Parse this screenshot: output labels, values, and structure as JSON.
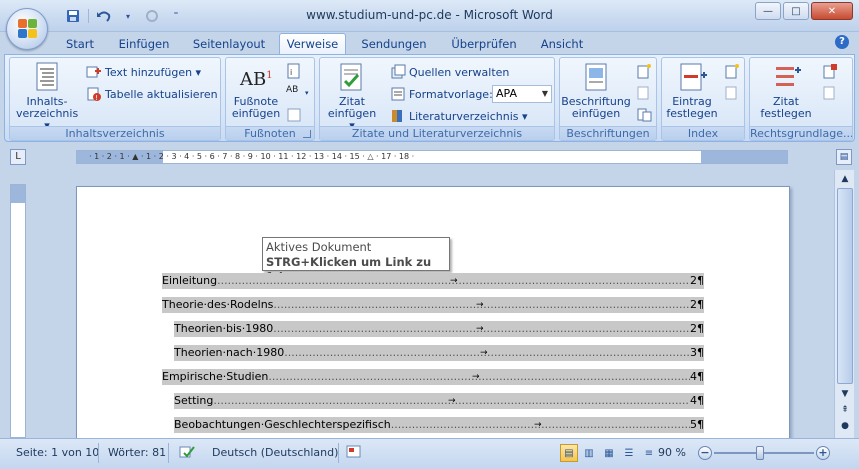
{
  "window": {
    "title": "www.studium-und-pc.de - Microsoft Word",
    "controls": {
      "minimize": "—",
      "maximize": "□",
      "close": "✕"
    }
  },
  "qat": {
    "save_icon": "save-icon",
    "undo_icon": "undo-icon",
    "redo_icon": "redo-icon",
    "customize_icon": "chevron-down-icon"
  },
  "tabs": [
    {
      "label": "Start",
      "active": false
    },
    {
      "label": "Einfügen",
      "active": false
    },
    {
      "label": "Seitenlayout",
      "active": false
    },
    {
      "label": "Verweise",
      "active": true
    },
    {
      "label": "Sendungen",
      "active": false
    },
    {
      "label": "Überprüfen",
      "active": false
    },
    {
      "label": "Ansicht",
      "active": false
    }
  ],
  "ribbon": {
    "groups": [
      {
        "label": "Inhaltsverzeichnis",
        "big": {
          "line1": "Inhalts-",
          "line2": "verzeichnis ▾"
        },
        "small": [
          {
            "label": "Text hinzufügen ▾"
          },
          {
            "label": "Tabelle aktualisieren"
          }
        ]
      },
      {
        "label": "Fußnoten",
        "big": {
          "line1": "Fußnote",
          "line2": "einfügen",
          "icon_text": "AB",
          "sup": "1"
        }
      },
      {
        "label": "Zitate und Literaturverzeichnis",
        "big": {
          "line1": "Zitat",
          "line2": "einfügen ▾"
        },
        "small": [
          {
            "label": "Quellen verwalten"
          },
          {
            "label": "Formatvorlage:"
          },
          {
            "label": "Literaturverzeichnis ▾"
          }
        ],
        "style_value": "APA"
      },
      {
        "label": "Beschriftungen",
        "big": {
          "line1": "Beschriftung",
          "line2": "einfügen"
        }
      },
      {
        "label": "Index",
        "big": {
          "line1": "Eintrag",
          "line2": "festlegen"
        }
      },
      {
        "label": "Rechtsgrundlage...",
        "big": {
          "line1": "Zitat",
          "line2": "festlegen"
        }
      }
    ]
  },
  "ruler": {
    "numbers": "· 1 · 2 · 1 · ▲ · 1 · 2 · 3 · 4 · 5 · 6 · 7 · 8 · 9 · 10 · 11 · 12 · 13 · 14 · 15 · △ · 17 · 18 ·",
    "corner": "L"
  },
  "tooltip": {
    "line1": "Aktives Dokument",
    "line2": "STRG+Klicken um Link zu folgen"
  },
  "toc": [
    {
      "text": "Einleitung",
      "page": "2¶",
      "level": 1
    },
    {
      "text": "Theorie·des·Rodelns",
      "page": "2¶",
      "level": 1
    },
    {
      "text": "Theorien·bis·1980",
      "page": "2¶",
      "level": 2
    },
    {
      "text": "Theorien·nach·1980",
      "page": "3¶",
      "level": 2
    },
    {
      "text": "Empirische·Studien",
      "page": "4¶",
      "level": 1
    },
    {
      "text": "Setting",
      "page": "4¶",
      "level": 2
    },
    {
      "text": "Beobachtungen·Geschlechterspezifisch",
      "page": "5¶",
      "level": 2
    }
  ],
  "statusbar": {
    "page": "Seite: 1 von 10",
    "words": "Wörter: 81",
    "language": "Deutsch (Deutschland)",
    "zoom": "90 %",
    "zoom_out": "−",
    "zoom_in": "+"
  },
  "colors": {
    "accent": "#15428b",
    "ribbon": "#dbe8f8",
    "toc_highlight": "#c8c8c8"
  }
}
